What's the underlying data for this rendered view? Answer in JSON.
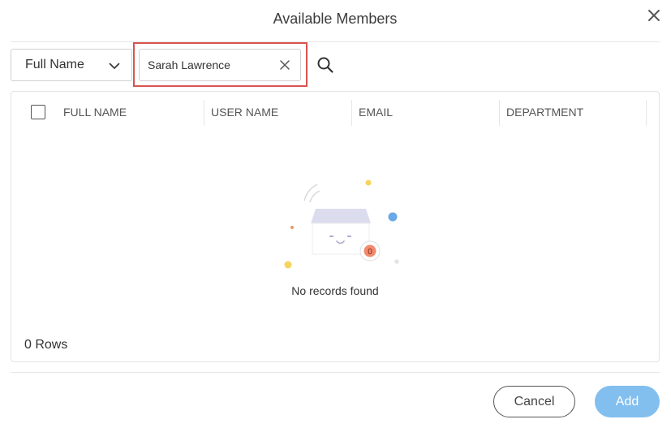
{
  "dialog": {
    "title": "Available Members",
    "close_icon": "close-icon"
  },
  "filter": {
    "field_selected": "Full Name",
    "search_value": "Sarah Lawrence",
    "clear_icon": "clear-icon",
    "search_icon": "search-icon"
  },
  "grid": {
    "columns": [
      "FULL NAME",
      "USER NAME",
      "EMAIL",
      "DEPARTMENT"
    ],
    "empty_message": "No records found",
    "empty_badge": "0",
    "row_count": "0 Rows"
  },
  "footer": {
    "cancel_label": "Cancel",
    "add_label": "Add"
  },
  "colors": {
    "primary_disabled": "#82bfef",
    "highlight": "#d9534f"
  }
}
